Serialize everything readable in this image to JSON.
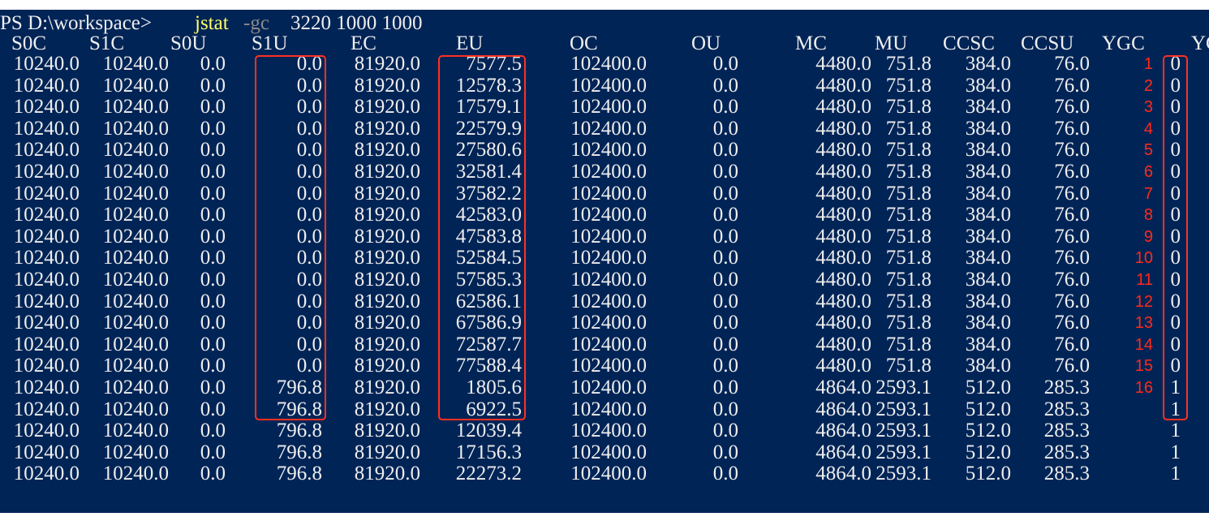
{
  "prompt": {
    "path": "PS D:\\workspace>",
    "command": "jstat",
    "flag": "-gc",
    "args": "3220 1000 1000"
  },
  "headers": [
    "S0C",
    "S1C",
    "S0U",
    "S1U",
    "EC",
    "EU",
    "OC",
    "OU",
    "MC",
    "MU",
    "CCSC",
    "CCSU",
    "YGC",
    "YG"
  ],
  "rows": [
    {
      "S0C": "10240.0",
      "S1C": "10240.0",
      "S0U": "0.0",
      "S1U": "0.0",
      "EC": "81920.0",
      "EU": "7577.5",
      "OC": "102400.0",
      "OU": "0.0",
      "MC": "4480.0",
      "MU": "751.8",
      "CCSC": "384.0",
      "CCSU": "76.0",
      "ann": "1",
      "YGC": "0"
    },
    {
      "S0C": "10240.0",
      "S1C": "10240.0",
      "S0U": "0.0",
      "S1U": "0.0",
      "EC": "81920.0",
      "EU": "12578.3",
      "OC": "102400.0",
      "OU": "0.0",
      "MC": "4480.0",
      "MU": "751.8",
      "CCSC": "384.0",
      "CCSU": "76.0",
      "ann": "2",
      "YGC": "0"
    },
    {
      "S0C": "10240.0",
      "S1C": "10240.0",
      "S0U": "0.0",
      "S1U": "0.0",
      "EC": "81920.0",
      "EU": "17579.1",
      "OC": "102400.0",
      "OU": "0.0",
      "MC": "4480.0",
      "MU": "751.8",
      "CCSC": "384.0",
      "CCSU": "76.0",
      "ann": "3",
      "YGC": "0"
    },
    {
      "S0C": "10240.0",
      "S1C": "10240.0",
      "S0U": "0.0",
      "S1U": "0.0",
      "EC": "81920.0",
      "EU": "22579.9",
      "OC": "102400.0",
      "OU": "0.0",
      "MC": "4480.0",
      "MU": "751.8",
      "CCSC": "384.0",
      "CCSU": "76.0",
      "ann": "4",
      "YGC": "0"
    },
    {
      "S0C": "10240.0",
      "S1C": "10240.0",
      "S0U": "0.0",
      "S1U": "0.0",
      "EC": "81920.0",
      "EU": "27580.6",
      "OC": "102400.0",
      "OU": "0.0",
      "MC": "4480.0",
      "MU": "751.8",
      "CCSC": "384.0",
      "CCSU": "76.0",
      "ann": "5",
      "YGC": "0"
    },
    {
      "S0C": "10240.0",
      "S1C": "10240.0",
      "S0U": "0.0",
      "S1U": "0.0",
      "EC": "81920.0",
      "EU": "32581.4",
      "OC": "102400.0",
      "OU": "0.0",
      "MC": "4480.0",
      "MU": "751.8",
      "CCSC": "384.0",
      "CCSU": "76.0",
      "ann": "6",
      "YGC": "0"
    },
    {
      "S0C": "10240.0",
      "S1C": "10240.0",
      "S0U": "0.0",
      "S1U": "0.0",
      "EC": "81920.0",
      "EU": "37582.2",
      "OC": "102400.0",
      "OU": "0.0",
      "MC": "4480.0",
      "MU": "751.8",
      "CCSC": "384.0",
      "CCSU": "76.0",
      "ann": "7",
      "YGC": "0"
    },
    {
      "S0C": "10240.0",
      "S1C": "10240.0",
      "S0U": "0.0",
      "S1U": "0.0",
      "EC": "81920.0",
      "EU": "42583.0",
      "OC": "102400.0",
      "OU": "0.0",
      "MC": "4480.0",
      "MU": "751.8",
      "CCSC": "384.0",
      "CCSU": "76.0",
      "ann": "8",
      "YGC": "0"
    },
    {
      "S0C": "10240.0",
      "S1C": "10240.0",
      "S0U": "0.0",
      "S1U": "0.0",
      "EC": "81920.0",
      "EU": "47583.8",
      "OC": "102400.0",
      "OU": "0.0",
      "MC": "4480.0",
      "MU": "751.8",
      "CCSC": "384.0",
      "CCSU": "76.0",
      "ann": "9",
      "YGC": "0"
    },
    {
      "S0C": "10240.0",
      "S1C": "10240.0",
      "S0U": "0.0",
      "S1U": "0.0",
      "EC": "81920.0",
      "EU": "52584.5",
      "OC": "102400.0",
      "OU": "0.0",
      "MC": "4480.0",
      "MU": "751.8",
      "CCSC": "384.0",
      "CCSU": "76.0",
      "ann": "10",
      "YGC": "0"
    },
    {
      "S0C": "10240.0",
      "S1C": "10240.0",
      "S0U": "0.0",
      "S1U": "0.0",
      "EC": "81920.0",
      "EU": "57585.3",
      "OC": "102400.0",
      "OU": "0.0",
      "MC": "4480.0",
      "MU": "751.8",
      "CCSC": "384.0",
      "CCSU": "76.0",
      "ann": "11",
      "YGC": "0"
    },
    {
      "S0C": "10240.0",
      "S1C": "10240.0",
      "S0U": "0.0",
      "S1U": "0.0",
      "EC": "81920.0",
      "EU": "62586.1",
      "OC": "102400.0",
      "OU": "0.0",
      "MC": "4480.0",
      "MU": "751.8",
      "CCSC": "384.0",
      "CCSU": "76.0",
      "ann": "12",
      "YGC": "0"
    },
    {
      "S0C": "10240.0",
      "S1C": "10240.0",
      "S0U": "0.0",
      "S1U": "0.0",
      "EC": "81920.0",
      "EU": "67586.9",
      "OC": "102400.0",
      "OU": "0.0",
      "MC": "4480.0",
      "MU": "751.8",
      "CCSC": "384.0",
      "CCSU": "76.0",
      "ann": "13",
      "YGC": "0"
    },
    {
      "S0C": "10240.0",
      "S1C": "10240.0",
      "S0U": "0.0",
      "S1U": "0.0",
      "EC": "81920.0",
      "EU": "72587.7",
      "OC": "102400.0",
      "OU": "0.0",
      "MC": "4480.0",
      "MU": "751.8",
      "CCSC": "384.0",
      "CCSU": "76.0",
      "ann": "14",
      "YGC": "0"
    },
    {
      "S0C": "10240.0",
      "S1C": "10240.0",
      "S0U": "0.0",
      "S1U": "0.0",
      "EC": "81920.0",
      "EU": "77588.4",
      "OC": "102400.0",
      "OU": "0.0",
      "MC": "4480.0",
      "MU": "751.8",
      "CCSC": "384.0",
      "CCSU": "76.0",
      "ann": "15",
      "YGC": "0"
    },
    {
      "S0C": "10240.0",
      "S1C": "10240.0",
      "S0U": "0.0",
      "S1U": "796.8",
      "EC": "81920.0",
      "EU": "1805.6",
      "OC": "102400.0",
      "OU": "0.0",
      "MC": "4864.0",
      "MU": "2593.1",
      "CCSC": "512.0",
      "CCSU": "285.3",
      "ann": "16",
      "YGC": "1"
    },
    {
      "S0C": "10240.0",
      "S1C": "10240.0",
      "S0U": "0.0",
      "S1U": "796.8",
      "EC": "81920.0",
      "EU": "6922.5",
      "OC": "102400.0",
      "OU": "0.0",
      "MC": "4864.0",
      "MU": "2593.1",
      "CCSC": "512.0",
      "CCSU": "285.3",
      "ann": "",
      "YGC": "1"
    },
    {
      "S0C": "10240.0",
      "S1C": "10240.0",
      "S0U": "0.0",
      "S1U": "796.8",
      "EC": "81920.0",
      "EU": "12039.4",
      "OC": "102400.0",
      "OU": "0.0",
      "MC": "4864.0",
      "MU": "2593.1",
      "CCSC": "512.0",
      "CCSU": "285.3",
      "ann": "",
      "YGC": "1"
    },
    {
      "S0C": "10240.0",
      "S1C": "10240.0",
      "S0U": "0.0",
      "S1U": "796.8",
      "EC": "81920.0",
      "EU": "17156.3",
      "OC": "102400.0",
      "OU": "0.0",
      "MC": "4864.0",
      "MU": "2593.1",
      "CCSC": "512.0",
      "CCSU": "285.3",
      "ann": "",
      "YGC": "1"
    },
    {
      "S0C": "10240.0",
      "S1C": "10240.0",
      "S0U": "0.0",
      "S1U": "796.8",
      "EC": "81920.0",
      "EU": "22273.2",
      "OC": "102400.0",
      "OU": "0.0",
      "MC": "4864.0",
      "MU": "2593.1",
      "CCSC": "512.0",
      "CCSU": "285.3",
      "ann": "",
      "YGC": "1"
    }
  ],
  "colors": {
    "background": "#012456",
    "text": "#eeeeee",
    "command": "#ffff66",
    "flag": "#8a8a8a",
    "annotation": "#ff2a1a"
  }
}
